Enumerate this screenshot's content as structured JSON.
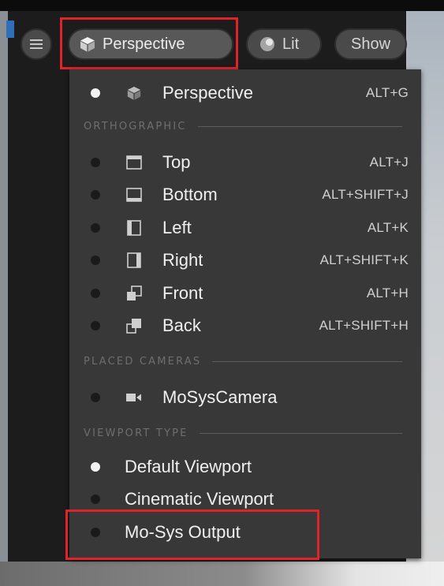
{
  "toolbar": {
    "menu_icon": "hamburger-icon",
    "perspective_label": "Perspective",
    "perspective_icon": "cube-icon",
    "lit_label": "Lit",
    "lit_icon": "sphere-icon",
    "show_label": "Show"
  },
  "menu": {
    "perspective": {
      "label": "Perspective",
      "shortcut": "ALT+G",
      "icon": "cube-icon",
      "selected": true
    },
    "orthographic_header": "ORTHOGRAPHIC",
    "orthographic_items": [
      {
        "label": "Top",
        "shortcut": "ALT+J",
        "icon": "view-top-icon"
      },
      {
        "label": "Bottom",
        "shortcut": "ALT+SHIFT+J",
        "icon": "view-bottom-icon"
      },
      {
        "label": "Left",
        "shortcut": "ALT+K",
        "icon": "view-left-icon"
      },
      {
        "label": "Right",
        "shortcut": "ALT+SHIFT+K",
        "icon": "view-right-icon"
      },
      {
        "label": "Front",
        "shortcut": "ALT+H",
        "icon": "view-front-icon"
      },
      {
        "label": "Back",
        "shortcut": "ALT+SHIFT+H",
        "icon": "view-back-icon"
      }
    ],
    "placed_cameras_header": "PLACED CAMERAS",
    "camera": {
      "label": "MoSysCamera",
      "icon": "camera-icon"
    },
    "viewport_type_header": "VIEWPORT TYPE",
    "viewport_types": [
      {
        "label": "Default Viewport",
        "selected": true
      },
      {
        "label": "Cinematic Viewport",
        "selected": false
      },
      {
        "label": "Mo-Sys Output",
        "selected": false
      }
    ]
  },
  "colors": {
    "highlight": "#e0232a",
    "menu_bg": "#383838",
    "text": "#f0f0f0",
    "section_text": "#6e6e6e"
  }
}
